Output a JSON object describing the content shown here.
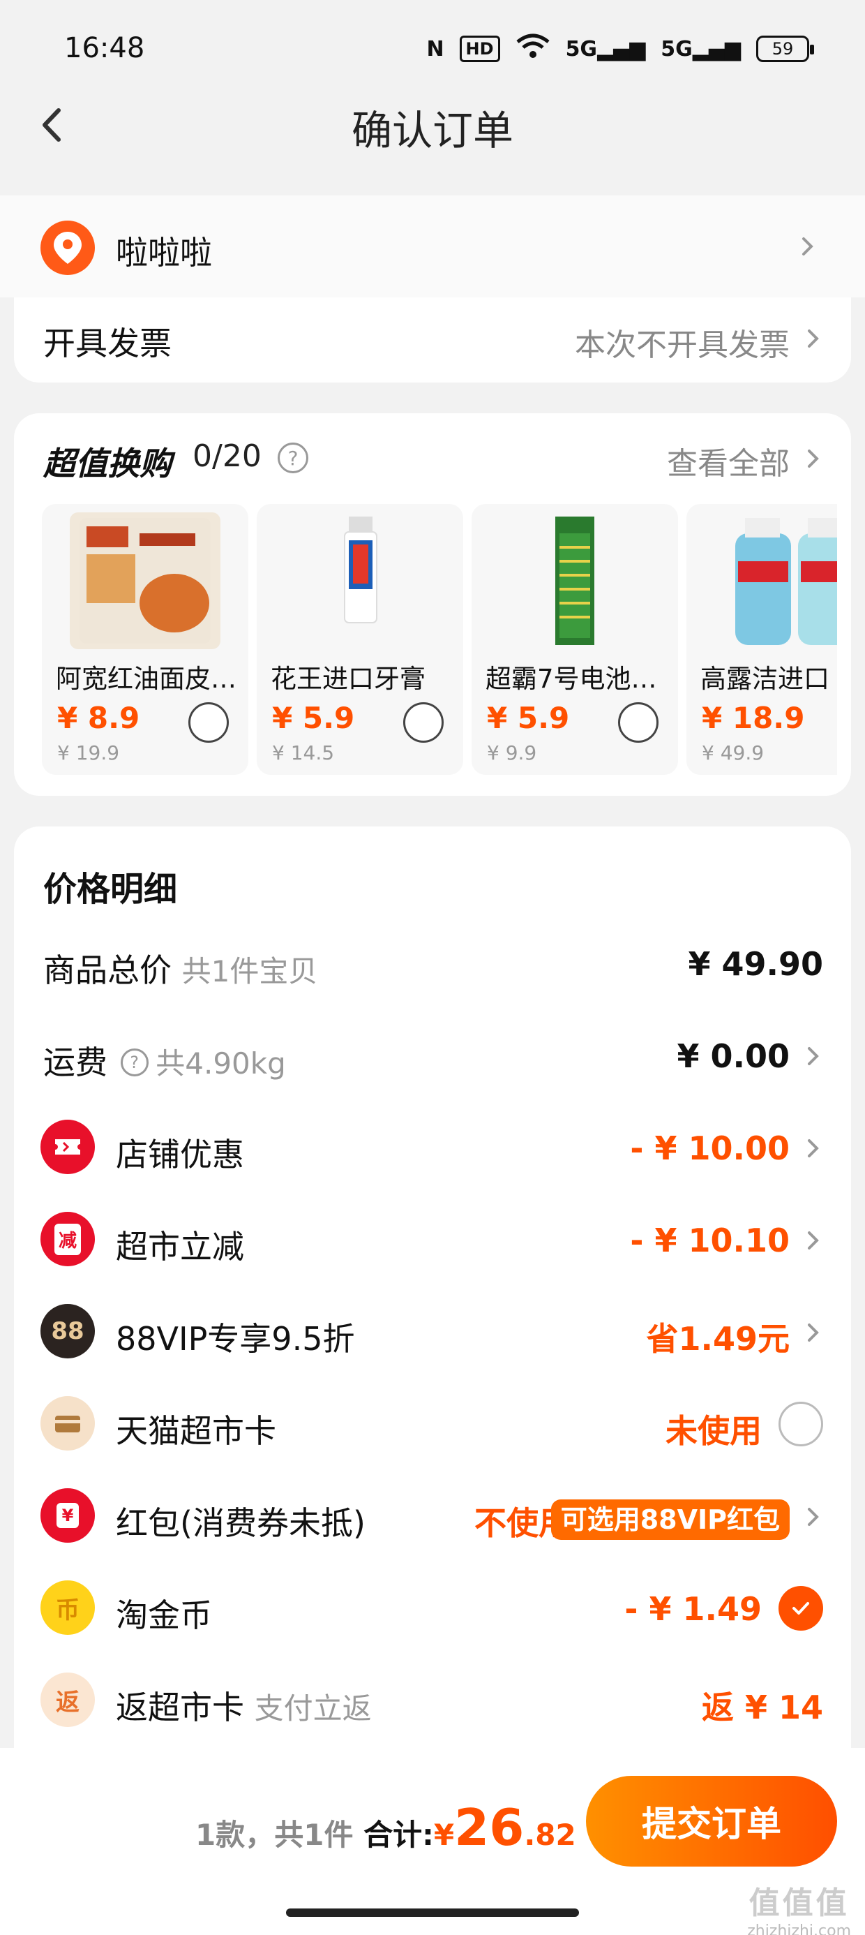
{
  "status": {
    "time": "16:48",
    "nfc": "N",
    "hd": "HD",
    "net1": "5G",
    "net2": "5G",
    "battery": "59"
  },
  "nav": {
    "title": "确认订单"
  },
  "address": {
    "name": "啦啦啦"
  },
  "invoice": {
    "label": "开具发票",
    "value": "本次不开具发票"
  },
  "swap": {
    "title": "超值换购",
    "count": "0/20",
    "view_all": "查看全部",
    "products": [
      {
        "name": "阿宽红油面皮…",
        "price": "¥ 8.9",
        "original": "¥ 19.9"
      },
      {
        "name": "花王进口牙膏",
        "price": "¥ 5.9",
        "original": "¥ 14.5"
      },
      {
        "name": "超霸7号电池1…",
        "price": "¥ 5.9",
        "original": "¥ 9.9"
      },
      {
        "name": "高露洁进口",
        "price": "¥ 18.9",
        "original": "¥ 49.9"
      }
    ]
  },
  "price": {
    "title": "价格明细",
    "rows": [
      {
        "label": "商品总价",
        "sub": "共1件宝贝",
        "value": "¥ 49.90"
      },
      {
        "label": "运费",
        "sub": "共4.90kg",
        "value": "¥ 0.00"
      },
      {
        "label": "店铺优惠",
        "value": "- ¥ 10.00"
      },
      {
        "label": "超市立减",
        "icon_text": "减",
        "value": "- ¥ 10.10"
      },
      {
        "label": "88VIP专享9.5折",
        "icon_text": "88",
        "value": "省1.49元"
      },
      {
        "label": "天猫超市卡",
        "value": "未使用"
      },
      {
        "label": "红包(消费券未抵)",
        "icon_text": "¥",
        "value": "不使用",
        "badge": "可选用88VIP红包"
      },
      {
        "label": "淘金币",
        "icon_text": "币",
        "value": "- ¥ 1.49"
      },
      {
        "label": "返超市卡",
        "sub": "支付立返",
        "icon_text": "返",
        "value": "返 ¥ 14"
      }
    ]
  },
  "bottom": {
    "count_text": "1款，共1件",
    "total_label": "合计:",
    "currency": "¥",
    "total_int": "26",
    "total_dec": ".82",
    "submit": "提交订单"
  },
  "watermark": {
    "big": "值值值",
    "small": "zhizhizhi.com"
  },
  "colors": {
    "accent": "#ff5000",
    "button_start": "#ff9000",
    "button_end": "#ff4f00"
  }
}
